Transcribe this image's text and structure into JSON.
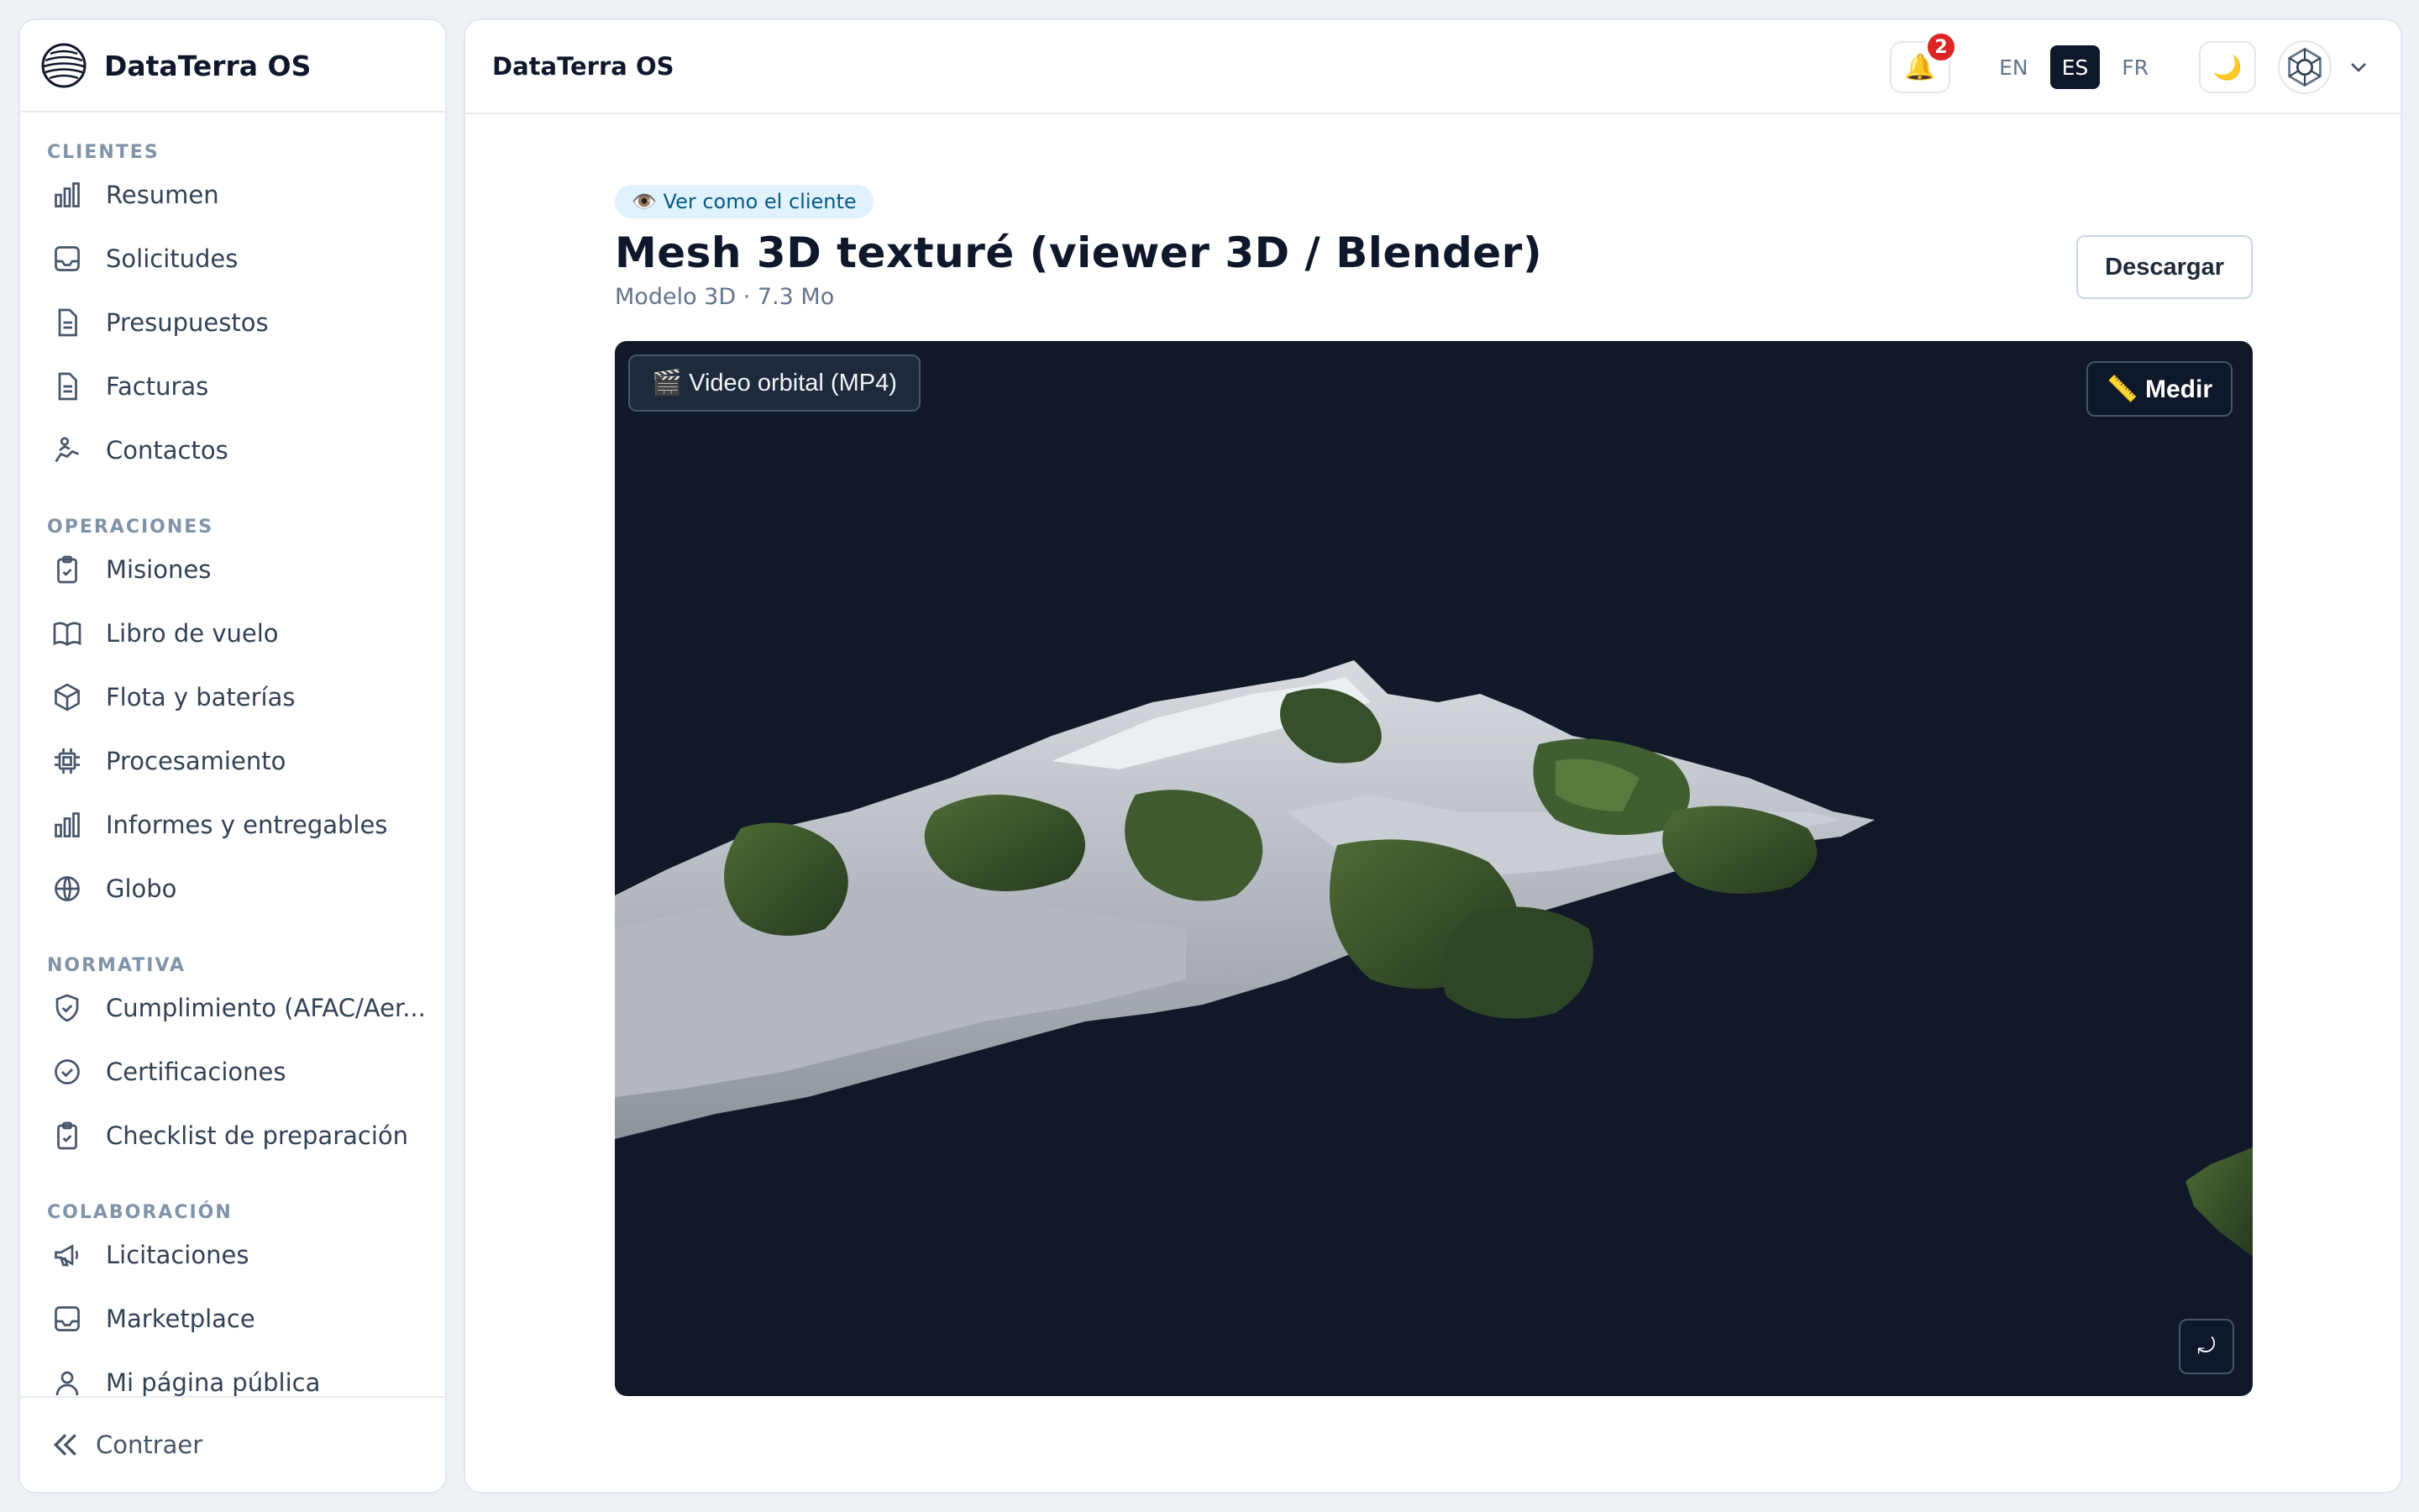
{
  "sidebar": {
    "brand": "DataTerra OS",
    "sections": [
      {
        "title": "CLIENTES",
        "items": [
          {
            "label": "Resumen",
            "icon": "bar-chart-icon"
          },
          {
            "label": "Solicitudes",
            "icon": "inbox-icon"
          },
          {
            "label": "Presupuestos",
            "icon": "document-icon"
          },
          {
            "label": "Facturas",
            "icon": "document-icon"
          },
          {
            "label": "Contactos",
            "icon": "handshake-icon"
          }
        ]
      },
      {
        "title": "OPERACIONES",
        "items": [
          {
            "label": "Misiones",
            "icon": "clipboard-check-icon"
          },
          {
            "label": "Libro de vuelo",
            "icon": "book-icon"
          },
          {
            "label": "Flota y baterías",
            "icon": "cube-icon"
          },
          {
            "label": "Procesamiento",
            "icon": "cpu-icon"
          },
          {
            "label": "Informes y entregables",
            "icon": "bar-chart-icon"
          },
          {
            "label": "Globo",
            "icon": "globe-icon"
          }
        ]
      },
      {
        "title": "NORMATIVA",
        "items": [
          {
            "label": "Cumplimiento (AFAC/Aer...",
            "icon": "shield-check-icon"
          },
          {
            "label": "Certificaciones",
            "icon": "check-circle-icon"
          },
          {
            "label": "Checklist de preparación",
            "icon": "clipboard-check-icon"
          }
        ]
      },
      {
        "title": "COLABORACIÓN",
        "items": [
          {
            "label": "Licitaciones",
            "icon": "megaphone-icon"
          },
          {
            "label": "Marketplace",
            "icon": "inbox-icon"
          },
          {
            "label": "Mi página pública",
            "icon": "user-icon"
          }
        ]
      }
    ],
    "collapse_label": "Contraer"
  },
  "topbar": {
    "title": "DataTerra OS",
    "notifications_count": "2",
    "languages": [
      "EN",
      "ES",
      "FR"
    ],
    "active_language": "ES",
    "theme_icon": "🌙"
  },
  "page": {
    "client_view_label": "👁️ Ver como el cliente",
    "title": "Mesh 3D texturé (viewer 3D / Blender)",
    "subtitle": "Modelo 3D · 7.3 Mo",
    "download_label": "Descargar"
  },
  "viewer": {
    "video_label": "🎬 Video orbital (MP4)",
    "measure_label": "📏 Medir",
    "reset_icon": "⤾"
  },
  "colors": {
    "viewer_bg": "#111827",
    "accent_dark": "#0f172a",
    "badge": "#dc2626",
    "pill_bg": "#e0f2fe"
  }
}
